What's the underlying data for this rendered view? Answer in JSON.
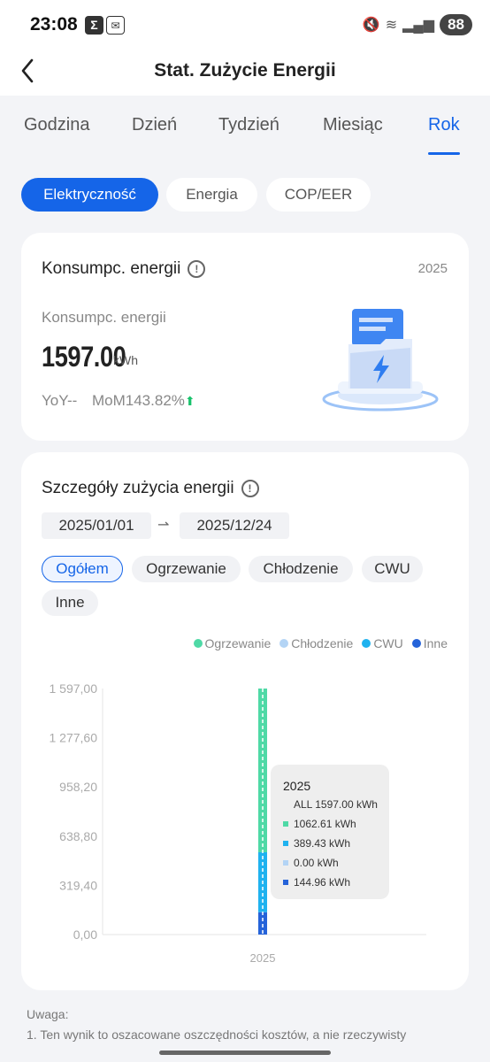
{
  "status": {
    "time": "23:08",
    "battery": "88"
  },
  "header": {
    "title": "Stat. Zużycie Energii",
    "back_icon": "back-arrow-icon"
  },
  "tabs": [
    "Godzina",
    "Dzień",
    "Tydzień",
    "Miesiąc",
    "Rok"
  ],
  "active_tab": "Rok",
  "pills": [
    "Elektryczność",
    "Energia",
    "COP/EER"
  ],
  "active_pill": "Elektryczność",
  "summary": {
    "title": "Konsumpc. energii",
    "year": "2025",
    "sub_label": "Konsumpc. energii",
    "value": "1597.00",
    "unit": "kWh",
    "yoy": "YoY--",
    "mom": "MoM143.82%"
  },
  "details": {
    "title": "Szczegóły zużycia energii",
    "date_from": "2025/01/01",
    "date_to": "2025/12/24",
    "date_sep": "⇀",
    "chips": [
      "Ogółem",
      "Ogrzewanie",
      "Chłodzenie",
      "CWU",
      "Inne"
    ],
    "active_chip": "Ogółem"
  },
  "colors": {
    "accent": "#1565e8",
    "heating": "#4fd9a6",
    "cooling": "#b3d4f5",
    "dhw": "#1fb2ef",
    "other": "#2563d9"
  },
  "chart_data": {
    "type": "bar",
    "stacked": true,
    "categories": [
      "2025"
    ],
    "series": [
      {
        "name": "Ogrzewanie",
        "values": [
          1062.61
        ]
      },
      {
        "name": "Chłodzenie",
        "values": [
          0.0
        ]
      },
      {
        "name": "CWU",
        "values": [
          389.43
        ]
      },
      {
        "name": "Inne",
        "values": [
          144.96
        ]
      }
    ],
    "ylim": [
      0,
      1597
    ],
    "y_ticks": [
      "1 597,00",
      "1 277,60",
      "958,20",
      "638,80",
      "319,40",
      "0,00"
    ],
    "legend_placement": "top-right",
    "grid": false
  },
  "tooltip": {
    "title": "2025",
    "total": "ALL 1597.00 kWh",
    "rows": [
      "1062.61 kWh",
      "389.43 kWh",
      "0.00 kWh",
      "144.96 kWh"
    ]
  },
  "note": {
    "title": "Uwaga:",
    "line1": "1. Ten wynik to oszacowane oszczędności kosztów, a nie rzeczywisty"
  }
}
